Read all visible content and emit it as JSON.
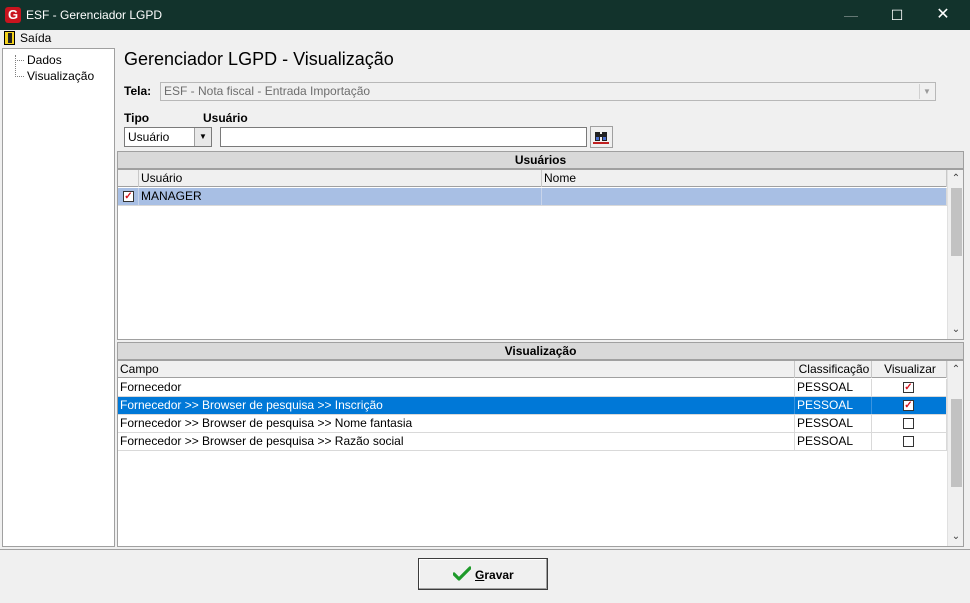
{
  "window": {
    "title": "ESF - Gerenciador LGPD",
    "logo_letter": "G"
  },
  "menu": {
    "exit_label": "Saída"
  },
  "tree": {
    "items": [
      "Dados",
      "Visualização"
    ]
  },
  "page": {
    "title": "Gerenciador LGPD - Visualização",
    "tela_label": "Tela:",
    "tela_value": "ESF - Nota fiscal - Entrada Importação",
    "tipo_label": "Tipo",
    "tipo_value": "Usuário",
    "usuario_label": "Usuário",
    "usuario_value": ""
  },
  "usuarios": {
    "header": "Usuários",
    "columns": [
      "Usuário",
      "Nome"
    ],
    "rows": [
      {
        "checked": true,
        "usuario": "MANAGER",
        "nome": ""
      }
    ]
  },
  "visualizacao": {
    "header": "Visualização",
    "columns": [
      "Campo",
      "Classificação",
      "Visualizar"
    ],
    "rows": [
      {
        "campo": "Fornecedor",
        "classificacao": "PESSOAL",
        "visualizar": true
      },
      {
        "campo": "Fornecedor >> Browser de pesquisa >> Inscrição",
        "classificacao": "PESSOAL",
        "visualizar": true
      },
      {
        "campo": "Fornecedor >> Browser de pesquisa >> Nome fantasia",
        "classificacao": "PESSOAL",
        "visualizar": false
      },
      {
        "campo": "Fornecedor >> Browser de pesquisa >> Razão social",
        "classificacao": "PESSOAL",
        "visualizar": false
      }
    ],
    "selected_row": 1
  },
  "footer": {
    "save_label": "Gravar"
  },
  "colors": {
    "titlebar": "#12332c",
    "selection": "#0078d7",
    "user_selection": "#a8bfe4",
    "check": "#d4141e"
  }
}
